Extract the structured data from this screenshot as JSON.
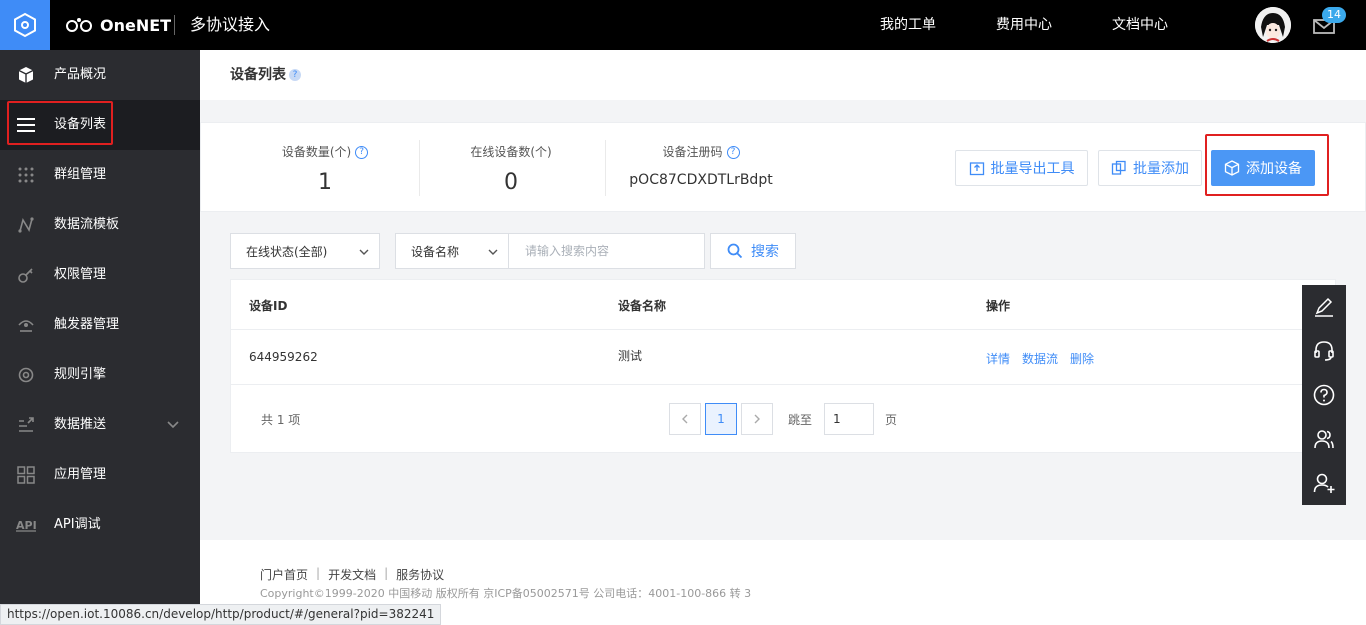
{
  "topbar": {
    "brand": "OneNET",
    "product": "多协议接入",
    "links": [
      "我的工单",
      "费用中心",
      "文档中心"
    ],
    "badge_count": "14"
  },
  "sidebar": {
    "items": [
      {
        "label": "产品概况",
        "icon": "cube-icon"
      },
      {
        "label": "设备列表",
        "icon": "list-icon"
      },
      {
        "label": "群组管理",
        "icon": "grid-dots-icon"
      },
      {
        "label": "数据流模板",
        "icon": "stream-icon"
      },
      {
        "label": "权限管理",
        "icon": "key-icon"
      },
      {
        "label": "触发器管理",
        "icon": "trigger-icon"
      },
      {
        "label": "规则引擎",
        "icon": "rule-icon"
      },
      {
        "label": "数据推送",
        "icon": "push-icon"
      },
      {
        "label": "应用管理",
        "icon": "apps-icon"
      },
      {
        "label": "API调试",
        "icon": "api-icon"
      }
    ]
  },
  "page": {
    "title": "设备列表",
    "stats": {
      "device_count_label": "设备数量(个)",
      "device_count": "1",
      "online_label": "在线设备数(个)",
      "online_count": "0",
      "regcode_label": "设备注册码",
      "regcode": "pOC87CDXDTLrBdpt"
    },
    "buttons": {
      "export": "批量导出工具",
      "batch_add": "批量添加",
      "add_device": "添加设备"
    },
    "filters": {
      "status_select": "在线状态(全部)",
      "field_select": "设备名称",
      "search_placeholder": "请输入搜索内容",
      "search_button": "搜索"
    },
    "table": {
      "headers": [
        "设备ID",
        "设备名称",
        "操作"
      ],
      "rows": [
        {
          "id": "644959262",
          "name": "测试",
          "ops": [
            "详情",
            "数据流",
            "删除"
          ]
        }
      ]
    },
    "pager": {
      "total": "共 1 项",
      "current": "1",
      "jump_label": "跳至",
      "jump_value": "1",
      "page_unit": "页"
    }
  },
  "footer": {
    "links": [
      "门户首页",
      "开发文档",
      "服务协议"
    ],
    "copyright": "Copyright©1999-2020 中国移动 版权所有 京ICP备05002571号 公司电话：4001-100-866 转 3"
  },
  "statusbar": {
    "url": "https://open.iot.10086.cn/develop/http/product/#/general?pid=382241"
  },
  "colors": {
    "accent": "#3f8cf7",
    "sidebar_bg": "#2b2c30",
    "highlight": "#e02020"
  }
}
